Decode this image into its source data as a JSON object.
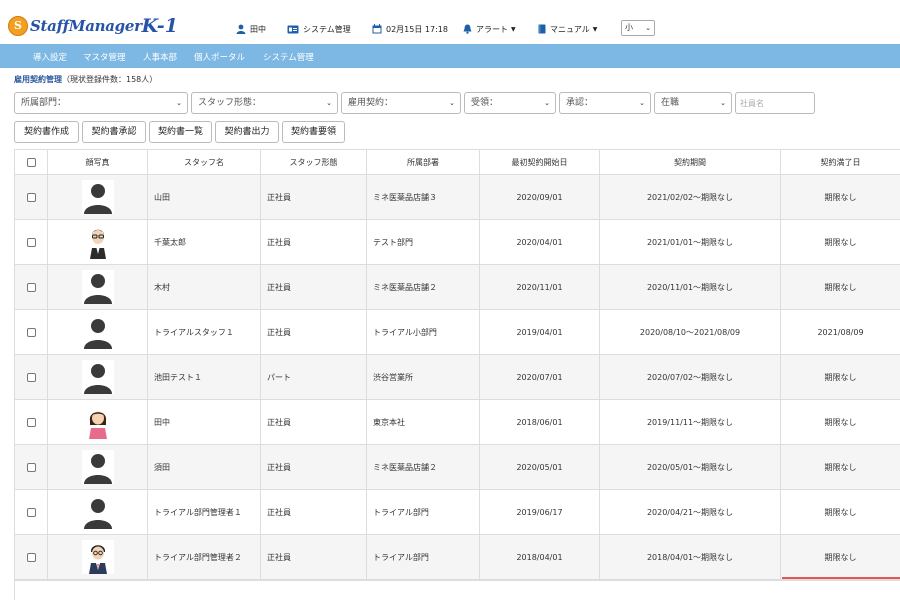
{
  "app": {
    "logo_mark": "S",
    "logo_text": "StaffManager",
    "logo_version": "K-1"
  },
  "header": {
    "user": "田中",
    "admin": "システム管理",
    "datetime": "02月15日 17:18",
    "alert": "アラート",
    "manual": "マニュアル",
    "font_size": "小"
  },
  "menu": [
    "導入設定",
    "マスタ管理",
    "人事本部",
    "個人ポータル",
    "システム管理"
  ],
  "page": {
    "title": "雇用契約管理",
    "count": "（現状登録件数：158人）"
  },
  "filters": {
    "dept": "所属部門：",
    "staff_type": "スタッフ形態：",
    "contract": "雇用契約：",
    "received": "受領：",
    "approval": "承認：",
    "status": "在職",
    "name_placeholder": "社員名"
  },
  "buttons": [
    "契約書作成",
    "契約書承認",
    "契約書一覧",
    "契約書出力",
    "契約書要領"
  ],
  "table": {
    "headers": [
      "",
      "顔写真",
      "スタッフ名",
      "スタッフ形態",
      "所属部署",
      "最初契約開始日",
      "契約期間",
      "契約満了日"
    ],
    "rows": [
      {
        "avatar": "silhouette",
        "name": "山田",
        "type": "正社員",
        "dept": "ミネ医薬品店舗３",
        "start": "2020/09/01",
        "period": "2021/02/02～期限なし",
        "end": "期限なし"
      },
      {
        "avatar": "man-glasses",
        "name": "千葉太郎",
        "type": "正社員",
        "dept": "テスト部門",
        "start": "2020/04/01",
        "period": "2021/01/01～期限なし",
        "end": "期限なし"
      },
      {
        "avatar": "silhouette",
        "name": "木村",
        "type": "正社員",
        "dept": "ミネ医薬品店舗２",
        "start": "2020/11/01",
        "period": "2020/11/01～期限なし",
        "end": "期限なし"
      },
      {
        "avatar": "silhouette",
        "name": "トライアルスタッフ１",
        "type": "正社員",
        "dept": "トライアル小部門",
        "start": "2019/04/01",
        "period": "2020/08/10～2021/08/09",
        "end": "2021/08/09"
      },
      {
        "avatar": "silhouette",
        "name": "池田テスト１",
        "type": "パート",
        "dept": "渋谷営業所",
        "start": "2020/07/01",
        "period": "2020/07/02～期限なし",
        "end": "期限なし"
      },
      {
        "avatar": "woman",
        "name": "田中",
        "type": "正社員",
        "dept": "東京本社",
        "start": "2018/06/01",
        "period": "2019/11/11～期限なし",
        "end": "期限なし"
      },
      {
        "avatar": "silhouette",
        "name": "須田",
        "type": "正社員",
        "dept": "ミネ医薬品店舗２",
        "start": "2020/05/01",
        "period": "2020/05/01～期限なし",
        "end": "期限なし"
      },
      {
        "avatar": "silhouette",
        "name": "トライアル部門管理者１",
        "type": "正社員",
        "dept": "トライアル部門",
        "start": "2019/06/17",
        "period": "2020/04/21～期限なし",
        "end": "期限なし"
      },
      {
        "avatar": "man-suit",
        "name": "トライアル部門管理者２",
        "type": "正社員",
        "dept": "トライアル部門",
        "start": "2018/04/01",
        "period": "2018/04/01～期限なし",
        "end": "期限なし"
      }
    ]
  },
  "colors": {
    "menu_bg": "#7db8e4",
    "brand_blue": "#2553a8",
    "accent_red": "#e05757"
  }
}
